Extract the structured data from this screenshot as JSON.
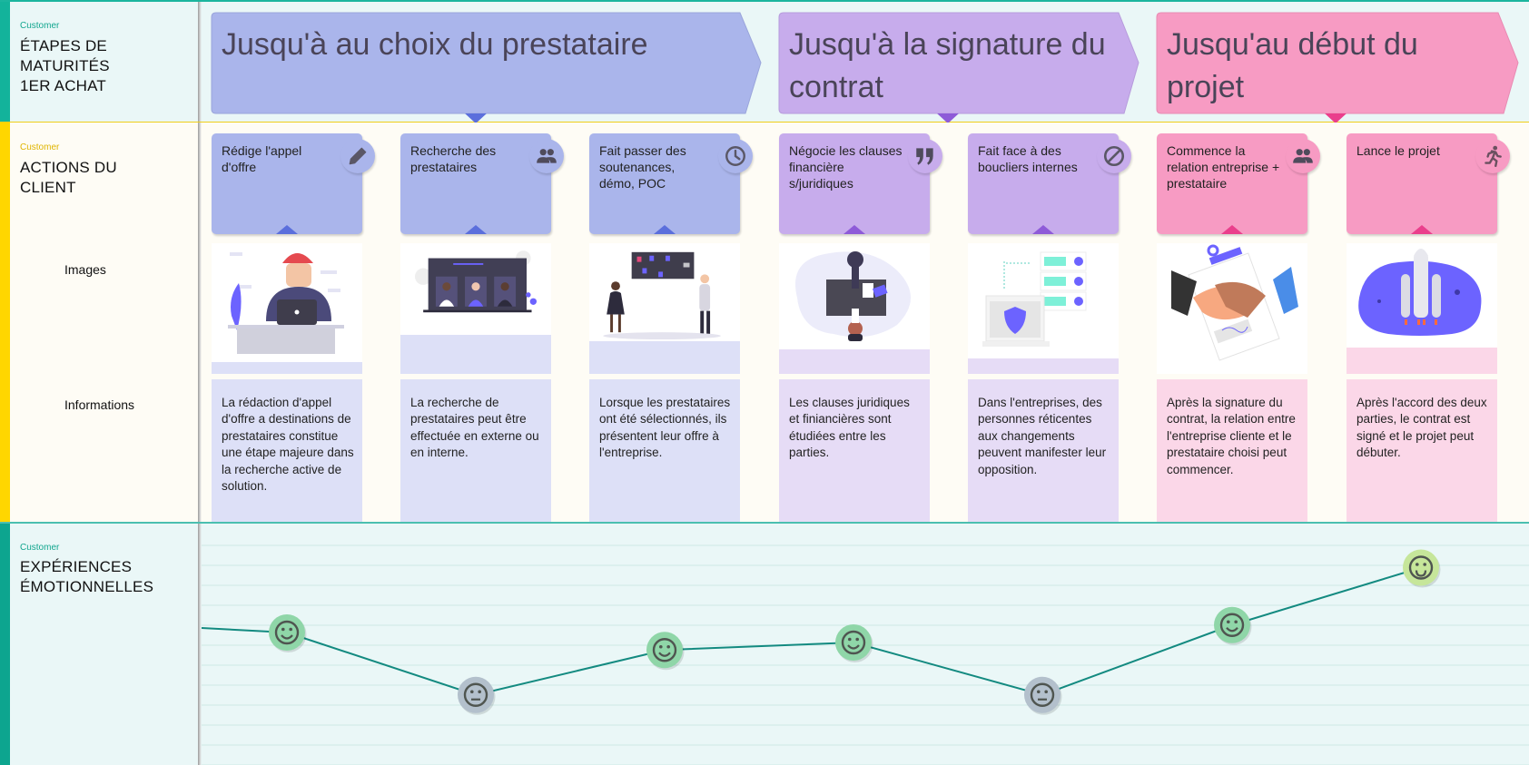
{
  "lanes": {
    "stages": {
      "kicker": "Customer",
      "title": "ÉTAPES DE MATURITÉS 1ER ACHAT"
    },
    "actions": {
      "kicker": "Customer",
      "title": "ACTIONS DU CLIENT",
      "sub_labels": {
        "images": "Images",
        "informations": "Informations"
      }
    },
    "emotions": {
      "kicker": "Customer",
      "title": "EXPÉRIENCES ÉMOTIONNELLES"
    }
  },
  "stages": [
    {
      "label": "Jusqu'à au choix du prestataire",
      "color": "#aab5eb",
      "accent": "#5b6fdc"
    },
    {
      "label": "Jusqu'à la signature du contrat",
      "color": "#c7acec",
      "accent": "#8e5bd8"
    },
    {
      "label": "Jusqu'au début du projet",
      "color": "#f79bc3",
      "accent": "#ea3f8c"
    }
  ],
  "actions": [
    {
      "label": "Rédige l'appel d'offre",
      "icon": "pencil-icon",
      "stage": 0,
      "info": "La rédaction d'appel d'offre a destinations de prestataires constitue une étape majeure dans la recherche active de solution.",
      "image": "person-at-laptop-illustration"
    },
    {
      "label": "Recherche des prestataires",
      "icon": "people-icon",
      "stage": 0,
      "info": "La recherche de prestataires peut être effectuée en externe ou en interne.",
      "image": "video-call-candidates-illustration"
    },
    {
      "label": "Fait passer des soutenances, démo, POC",
      "icon": "clock-icon",
      "stage": 0,
      "info": "Lorsque les prestataires ont été sélectionnés, ils présentent leur offre à l'entreprise.",
      "image": "presentation-board-illustration"
    },
    {
      "label": "Négocie les clauses financière s/juridiques",
      "icon": "quote-icon",
      "stage": 1,
      "info": "Les clauses juridiques et finiancières sont étudiées entre les parties.",
      "image": "negotiation-table-illustration"
    },
    {
      "label": "Fait face à des boucliers internes",
      "icon": "block-icon",
      "stage": 1,
      "info": "Dans l'entreprises, des personnes réticentes aux changements peuvent manifester leur opposition.",
      "image": "security-shield-illustration"
    },
    {
      "label": "Commence la relation entreprise + prestataire",
      "icon": "people-icon",
      "stage": 2,
      "info": "Après la signature du contrat, la relation entre l'entreprise cliente et le prestataire choisi peut commencer.",
      "image": "handshake-contract-illustration"
    },
    {
      "label": "Lance le projet",
      "icon": "running-person-icon",
      "stage": 2,
      "info": "Après l'accord des deux parties, le contrat est signé et le projet peut débuter.",
      "image": "rocket-launch-illustration"
    }
  ],
  "chart_data": {
    "type": "line",
    "title": "Expériences émotionnelles",
    "categories": [
      "Rédige l'appel d'offre",
      "Recherche des prestataires",
      "Fait passer des soutenances, démo, POC",
      "Négocie les clauses financières/juridiques",
      "Fait face à des boucliers internes",
      "Commence la relation entreprise + prestataire",
      "Lance le projet"
    ],
    "values": [
      4,
      1.5,
      3.3,
      3.6,
      1.5,
      4.3,
      6.6
    ],
    "moods": [
      "happy",
      "neutral",
      "happy",
      "happy",
      "neutral",
      "happy",
      "very-happy"
    ],
    "mood_colors": {
      "happy": "#8fd6a8",
      "neutral": "#b3c0cc",
      "very-happy": "#c6e69a"
    },
    "line_color": "#138a80",
    "ylim": [
      0,
      8
    ],
    "grid": true
  }
}
